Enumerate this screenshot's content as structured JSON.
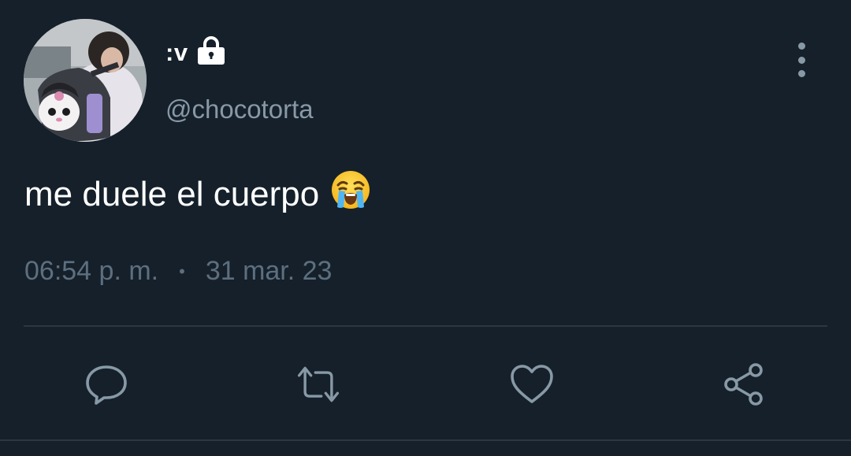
{
  "user": {
    "display_name": ":v",
    "handle": "@chocotorta",
    "protected_icon": "lock-icon"
  },
  "tweet": {
    "text": "me duele el cuerpo",
    "emoji": "loudly-crying-face",
    "time": "06:54 p. m.",
    "separator": "•",
    "date": "31 mar. 23"
  },
  "actions": {
    "reply_icon": "reply-icon",
    "retweet_icon": "retweet-icon",
    "like_icon": "heart-icon",
    "share_icon": "share-icon"
  },
  "colors": {
    "background": "#15202b",
    "primary_text": "#ffffff",
    "secondary_text": "#8899a6",
    "divider": "#2c3742"
  }
}
